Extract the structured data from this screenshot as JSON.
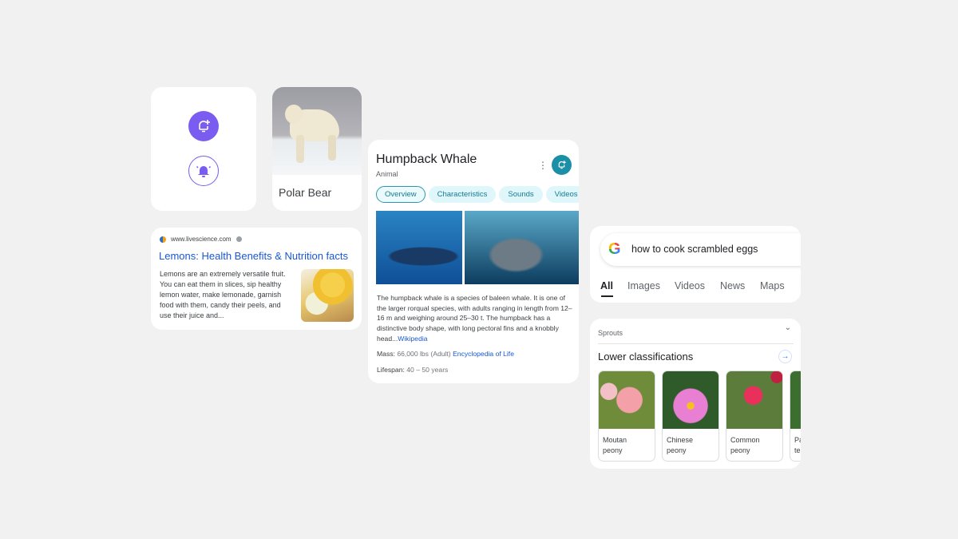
{
  "alerts_card": {
    "icons": [
      "bell-add-icon",
      "bell-ringing-icon"
    ],
    "accent": "#7b5cf0"
  },
  "polar_card": {
    "label": "Polar Bear"
  },
  "lemon_card": {
    "site": "www.livescience.com",
    "title": "Lemons: Health Benefits & Nutrition facts",
    "snippet": "Lemons are an extremely versatile fruit. You can eat them in slices, sip healthy lemon water, make lemonade, garnish food with them, candy their peels, and use their juice and..."
  },
  "whale_card": {
    "title": "Humpback Whale",
    "subtitle": "Animal",
    "accent": "#1a8fa6",
    "chips": [
      {
        "label": "Overview",
        "active": true
      },
      {
        "label": "Characteristics"
      },
      {
        "label": "Sounds"
      },
      {
        "label": "Videos"
      }
    ],
    "description": "The humpback whale is a species of baleen whale. It is one of the larger rorqual species, with adults ranging in length from 12–16 m and weighing around 25–30 t. The humpback has a distinctive body shape, with long pectoral fins and a knobbly head...",
    "source": "Wikipedia",
    "mass_label": "Mass:",
    "mass_value": "66,000 lbs (Adult)",
    "mass_source": "Encyclopedia of Life",
    "lifespan_label": "Lifespan:",
    "lifespan_value": "40 – 50 years"
  },
  "search_card": {
    "query": "how to cook scrambled eggs",
    "tabs": [
      "All",
      "Images",
      "Videos",
      "News",
      "Maps"
    ],
    "active_tab": "All"
  },
  "sprouts_card": {
    "header": "Sprouts",
    "section_title": "Lower classifications",
    "items": [
      {
        "line1": "Moutan",
        "line2": "peony"
      },
      {
        "line1": "Chinese",
        "line2": "peony"
      },
      {
        "line1": "Common",
        "line2": "peony"
      },
      {
        "line1": "Pa",
        "line2": "ter"
      }
    ]
  }
}
